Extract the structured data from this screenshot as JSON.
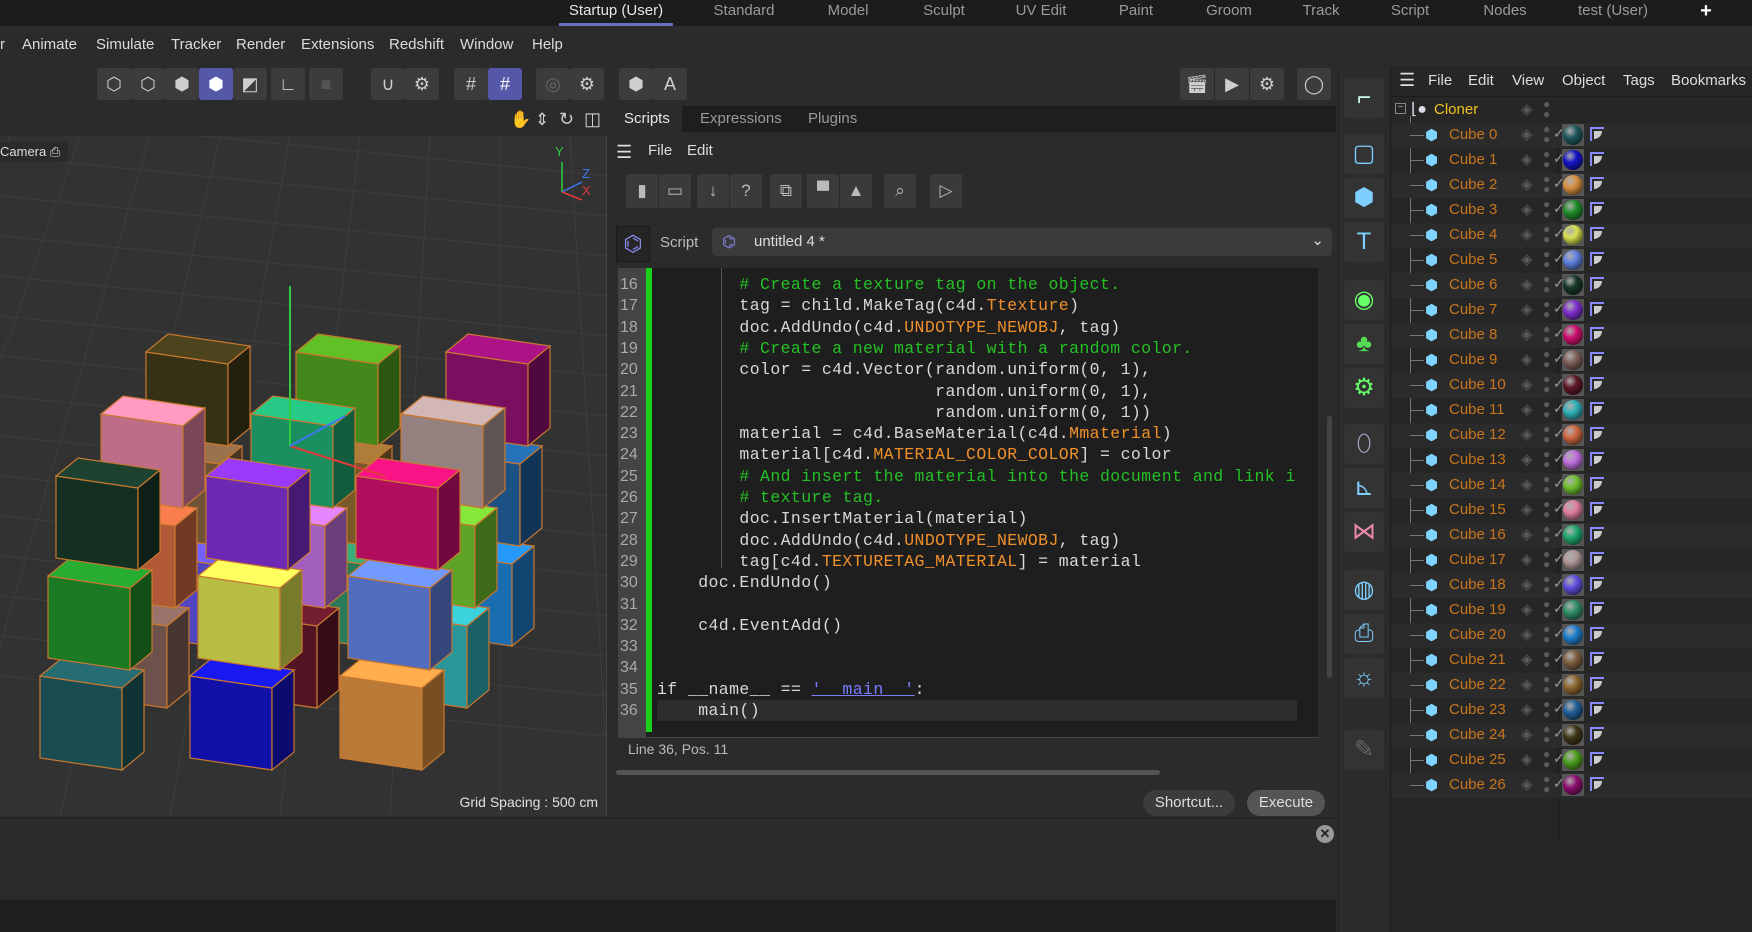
{
  "layouts": {
    "tabs": [
      "Startup (User)",
      "Standard",
      "Model",
      "Sculpt",
      "UV Edit",
      "Paint",
      "Groom",
      "Track",
      "Script",
      "Nodes",
      "test (User)"
    ],
    "active": "Startup (User)",
    "add": "+"
  },
  "menubar": [
    "r",
    "Animate",
    "Simulate",
    "Tracker",
    "Render",
    "Extensions",
    "Redshift",
    "Window",
    "Help"
  ],
  "viewport": {
    "camera": "Camera",
    "grid_spacing": "Grid Spacing : 500 cm",
    "axis": {
      "y": "Y",
      "z": "Z",
      "x": "X"
    }
  },
  "script_manager": {
    "tabs": [
      "Scripts",
      "Expressions",
      "Plugins"
    ],
    "menu": [
      "File",
      "Edit"
    ],
    "script_label": "Script",
    "script_name": "untitled 4 *",
    "status": "Line 36, Pos. 11",
    "shortcut": "Shortcut...",
    "execute": "Execute",
    "code": [
      {
        "n": "16",
        "t": [
          [
            "        ",
            "n"
          ],
          [
            "# Create a texture tag on the object.",
            "c"
          ]
        ]
      },
      {
        "n": "17",
        "t": [
          [
            "        tag = child.MakeTag(c4d.",
            "n"
          ],
          [
            "Ttexture",
            "o"
          ],
          [
            ")",
            "n"
          ]
        ]
      },
      {
        "n": "18",
        "t": [
          [
            "        doc.AddUndo(c4d.",
            "n"
          ],
          [
            "UNDOTYPE_NEWOBJ",
            "o"
          ],
          [
            ", tag)",
            "n"
          ]
        ]
      },
      {
        "n": "19",
        "t": [
          [
            "        ",
            "n"
          ],
          [
            "# Create a new material with a random color.",
            "c"
          ]
        ]
      },
      {
        "n": "20",
        "t": [
          [
            "        color = c4d.Vector(random.uniform(0, 1),",
            "n"
          ]
        ]
      },
      {
        "n": "21",
        "t": [
          [
            "                           random.uniform(0, 1),",
            "n"
          ]
        ]
      },
      {
        "n": "22",
        "t": [
          [
            "                           random.uniform(0, 1))",
            "n"
          ]
        ]
      },
      {
        "n": "23",
        "t": [
          [
            "        material = c4d.BaseMaterial(c4d.",
            "n"
          ],
          [
            "Mmaterial",
            "o"
          ],
          [
            ")",
            "n"
          ]
        ]
      },
      {
        "n": "24",
        "t": [
          [
            "        material[c4d.",
            "n"
          ],
          [
            "MATERIAL_COLOR_COLOR",
            "o"
          ],
          [
            "] = color",
            "n"
          ]
        ]
      },
      {
        "n": "25",
        "t": [
          [
            "        ",
            "n"
          ],
          [
            "# And insert the material into the document and link i",
            "c"
          ]
        ]
      },
      {
        "n": "26",
        "t": [
          [
            "        ",
            "n"
          ],
          [
            "# texture tag.",
            "c"
          ]
        ]
      },
      {
        "n": "27",
        "t": [
          [
            "        doc.InsertMaterial(material)",
            "n"
          ]
        ]
      },
      {
        "n": "28",
        "t": [
          [
            "        doc.AddUndo(c4d.",
            "n"
          ],
          [
            "UNDOTYPE_NEWOBJ",
            "o"
          ],
          [
            ", tag)",
            "n"
          ]
        ]
      },
      {
        "n": "29",
        "t": [
          [
            "        tag[c4d.",
            "n"
          ],
          [
            "TEXTURETAG_MATERIAL",
            "o"
          ],
          [
            "] = material",
            "n"
          ]
        ]
      },
      {
        "n": "30",
        "t": [
          [
            "    doc.EndUndo()",
            "n"
          ]
        ]
      },
      {
        "n": "31",
        "t": []
      },
      {
        "n": "32",
        "t": [
          [
            "    c4d.EventAdd()",
            "n"
          ]
        ]
      },
      {
        "n": "33",
        "t": []
      },
      {
        "n": "34",
        "t": []
      },
      {
        "n": "35",
        "t": [
          [
            "if __name__ == ",
            "n"
          ],
          [
            "'__main__'",
            "s"
          ],
          [
            ":",
            "n"
          ]
        ]
      },
      {
        "n": "36",
        "t": [
          [
            "    main()",
            "n"
          ]
        ]
      }
    ]
  },
  "object_manager": {
    "menu": [
      "File",
      "Edit",
      "View",
      "Object",
      "Tags",
      "Bookmarks"
    ],
    "root": "Cloner",
    "objects": [
      {
        "name": "Cube 0",
        "color": "#1f5a60"
      },
      {
        "name": "Cube 1",
        "color": "#1414c8"
      },
      {
        "name": "Cube 2",
        "color": "#d89040"
      },
      {
        "name": "Cube 3",
        "color": "#20902a"
      },
      {
        "name": "Cube 4",
        "color": "#d8e050"
      },
      {
        "name": "Cube 5",
        "color": "#6080e0"
      },
      {
        "name": "Cube 6",
        "color": "#183828"
      },
      {
        "name": "Cube 7",
        "color": "#8030d0"
      },
      {
        "name": "Cube 8",
        "color": "#d01070"
      },
      {
        "name": "Cube 9",
        "color": "#806058"
      },
      {
        "name": "Cube 10",
        "color": "#601828"
      },
      {
        "name": "Cube 11",
        "color": "#30b0b8"
      },
      {
        "name": "Cube 12",
        "color": "#d06840"
      },
      {
        "name": "Cube 13",
        "color": "#c070e0"
      },
      {
        "name": "Cube 14",
        "color": "#70c030"
      },
      {
        "name": "Cube 15",
        "color": "#e080a0"
      },
      {
        "name": "Cube 16",
        "color": "#20a870"
      },
      {
        "name": "Cube 17",
        "color": "#b09898"
      },
      {
        "name": "Cube 18",
        "color": "#6050e0"
      },
      {
        "name": "Cube 19",
        "color": "#309068"
      },
      {
        "name": "Cube 20",
        "color": "#2080d0"
      },
      {
        "name": "Cube 21",
        "color": "#806040"
      },
      {
        "name": "Cube 22",
        "color": "#906830"
      },
      {
        "name": "Cube 23",
        "color": "#20609a"
      },
      {
        "name": "Cube 24",
        "color": "#403818"
      },
      {
        "name": "Cube 25",
        "color": "#50a020"
      },
      {
        "name": "Cube 26",
        "color": "#901070"
      }
    ]
  },
  "colors": {
    "accent": "#5558a8",
    "object_name": "#c8761e",
    "root_name": "#f0c020",
    "comment": "#25c025",
    "constant": "#f0902a",
    "change_bar": "#19d119"
  }
}
